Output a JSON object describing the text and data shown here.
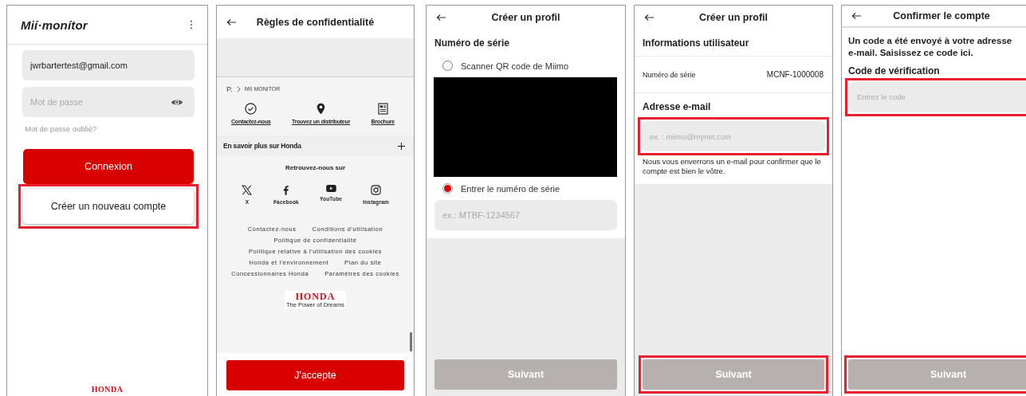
{
  "screens": [
    {
      "kind": "login",
      "logo": "Mií·monítor",
      "email": {
        "value": "jwrbartertest@gmail.com"
      },
      "password": {
        "placeholder": "Mot de passe"
      },
      "forgot_link": "Mot de passe oublié?",
      "buttons": [
        {
          "label": "Connexion",
          "kind": "primary",
          "highlighted": false
        },
        {
          "label": "Créer un nouveau compte",
          "kind": "secondary",
          "highlighted": true
        }
      ],
      "footer_logo": "HONDA"
    },
    {
      "kind": "privacy",
      "title": "Règles de confidentialité",
      "breadcrumb": [
        "P.",
        "MII MONITOR"
      ],
      "quick_links": [
        {
          "label": "Contactez-nous",
          "kind": "check"
        },
        {
          "label": "Trouvez un distributeur",
          "kind": "pin"
        },
        {
          "label": "Brochure",
          "kind": "brochure"
        }
      ],
      "section": {
        "label": "En savoir plus sur Honda",
        "expanded": false
      },
      "follow_title": "Retrouvez-nous sur",
      "socials": [
        {
          "label": "X",
          "kind": "x"
        },
        {
          "label": "Facebook",
          "kind": "facebook"
        },
        {
          "label": "YouTube",
          "kind": "youtube"
        },
        {
          "label": "Instagram",
          "kind": "instagram"
        }
      ],
      "footer_links": [
        [
          "Contactez-nous",
          "Conditions d'utilisation"
        ],
        [
          "Politique de confidentialité"
        ],
        [
          "Politique relative à l'utilisation des cookies"
        ],
        [
          "Honda et l'environnement",
          "Plan du site"
        ],
        [
          "Concessionnaires Honda",
          "Paramètres des cookies"
        ]
      ],
      "brand": {
        "name": "HONDA",
        "slogan": "The Power of Dreams"
      },
      "accept_button": "J'accepte"
    },
    {
      "kind": "serial",
      "title": "Créer un profil",
      "heading": "Numéro de série",
      "options": [
        {
          "label": "Scanner QR code de Miimo",
          "selected": false
        },
        {
          "label": "Entrer le numéro de série",
          "selected": true
        }
      ],
      "serial_field": {
        "placeholder": "ex.: MTBF-1234567"
      },
      "next_button": {
        "label": "Suivant",
        "disabled": true,
        "highlighted": false
      }
    },
    {
      "kind": "user_info",
      "title": "Créer un profil",
      "heading": "Informations utilisateur",
      "serial_row": {
        "label": "Numéro de série",
        "value": "MCNF-1000008"
      },
      "email_label": "Adresse e-mail",
      "email_field": {
        "placeholder": "ex. : miimo@mynet.com",
        "highlighted": true
      },
      "note": "Nous vous enverrons un e-mail pour confirmer que le compte est bien le vôtre.",
      "next_button": {
        "label": "Suivant",
        "disabled": true,
        "highlighted": true
      }
    },
    {
      "kind": "confirm",
      "title": "Confirmer le compte",
      "message": "Un code a été envoyé à votre adresse e-mail. Saisissez ce code ici.",
      "code_label": "Code de vérification",
      "code_field": {
        "placeholder": "Entrez le code",
        "highlighted": true
      },
      "next_button": {
        "label": "Suivant",
        "disabled": true,
        "highlighted": true
      }
    }
  ]
}
